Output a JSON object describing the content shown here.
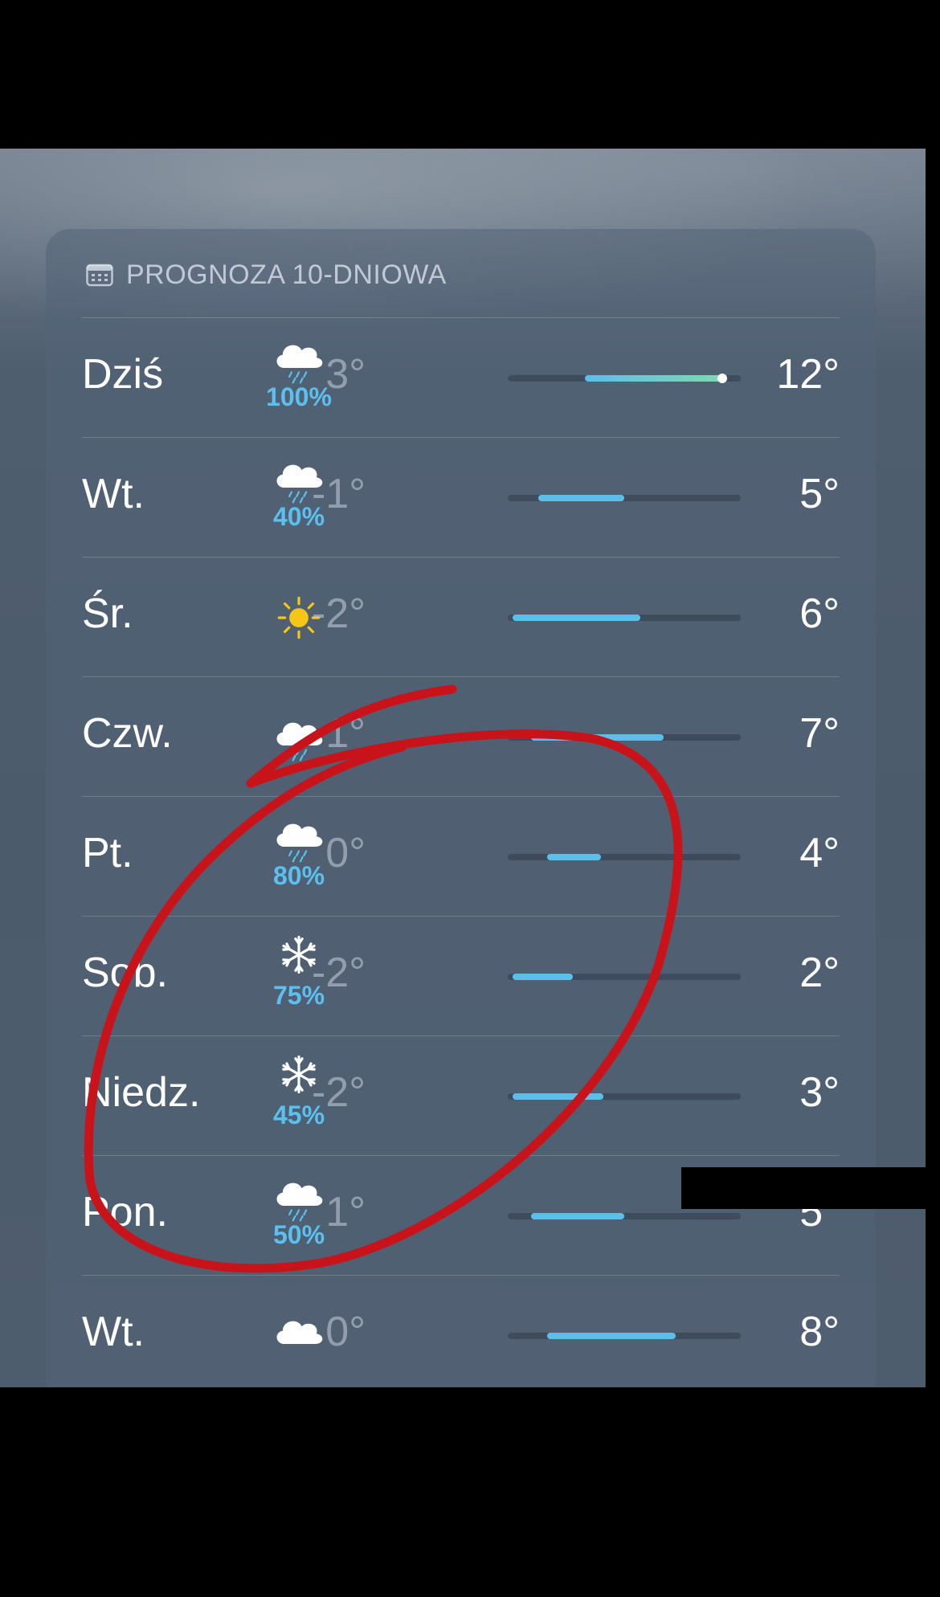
{
  "header": {
    "title": "PROGNOZA 10-DNIOWA",
    "icon": "calendar-icon"
  },
  "colors": {
    "precip": "#5bc0f0",
    "bar": "#5bbfea",
    "bar_today_end": "#7ed8b0",
    "sun": "#f5c518",
    "annotation": "#c8131a"
  },
  "forecast": [
    {
      "day": "Dziś",
      "icon": "rain-cloud-icon",
      "precip": "100%",
      "low": "3°",
      "high": "12°",
      "range_start": 0.33,
      "range_end": 0.92,
      "current": true
    },
    {
      "day": "Wt.",
      "icon": "rain-cloud-icon",
      "precip": "40%",
      "low": "-1°",
      "high": "5°",
      "range_start": 0.13,
      "range_end": 0.5
    },
    {
      "day": "Śr.",
      "icon": "sun-icon",
      "precip": "",
      "low": "-2°",
      "high": "6°",
      "range_start": 0.02,
      "range_end": 0.57
    },
    {
      "day": "Czw.",
      "icon": "rain-cloud-icon",
      "precip": "",
      "low": "1°",
      "high": "7°",
      "range_start": 0.1,
      "range_end": 0.67
    },
    {
      "day": "Pt.",
      "icon": "rain-cloud-icon",
      "precip": "80%",
      "low": "0°",
      "high": "4°",
      "range_start": 0.17,
      "range_end": 0.4
    },
    {
      "day": "Sob.",
      "icon": "snowflake-icon",
      "precip": "75%",
      "low": "-2°",
      "high": "2°",
      "range_start": 0.02,
      "range_end": 0.28
    },
    {
      "day": "Niedz.",
      "icon": "snowflake-icon",
      "precip": "45%",
      "low": "-2°",
      "high": "3°",
      "range_start": 0.02,
      "range_end": 0.41
    },
    {
      "day": "Pon.",
      "icon": "rain-cloud-icon",
      "precip": "50%",
      "low": "1°",
      "high": "5°",
      "range_start": 0.1,
      "range_end": 0.5
    },
    {
      "day": "Wt.",
      "icon": "cloud-icon",
      "precip": "",
      "low": "0°",
      "high": "8°",
      "range_start": 0.17,
      "range_end": 0.72
    }
  ]
}
